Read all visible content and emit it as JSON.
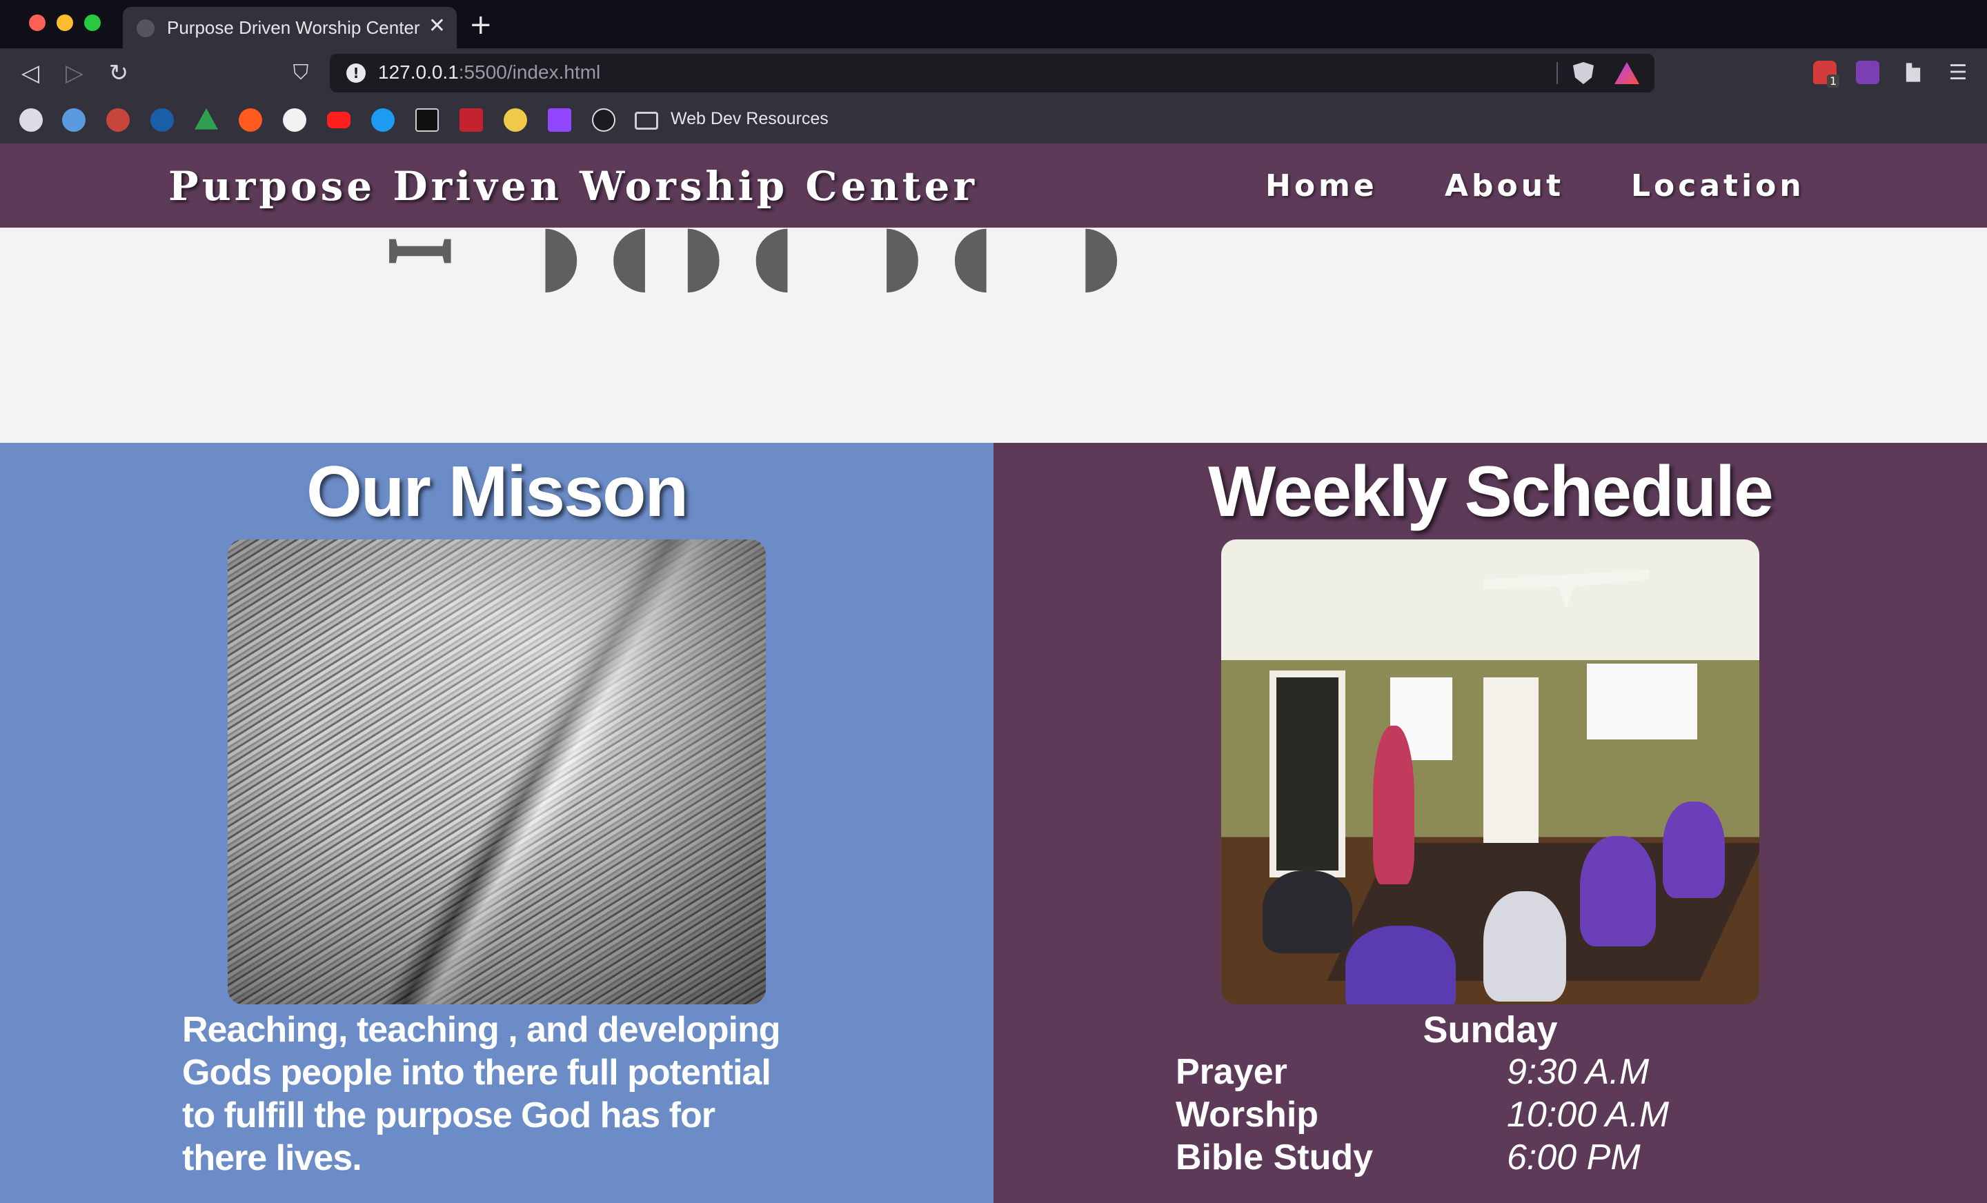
{
  "browser": {
    "tab_title": "Purpose Driven Worship Center",
    "tab_close": "✕",
    "new_tab": "+",
    "url_host": "127.0.0.1",
    "url_path": ":5500/index.html",
    "bookmark_folder_label": "Web Dev Resources",
    "extension_badge": "1",
    "nav_back": "◁",
    "nav_forward": "▷",
    "nav_reload": "↻",
    "menu": "☰"
  },
  "site": {
    "title": "Purpose Driven Worship Center",
    "nav": {
      "home": "Home",
      "about": "About",
      "location": "Location"
    }
  },
  "mission": {
    "heading": "Our Misson",
    "text": "Reaching, teaching , and developing Gods people into there full potential to fulfill the purpose God has for there lives."
  },
  "schedule": {
    "heading": "Weekly Schedule",
    "day": "Sunday",
    "items": [
      {
        "name": "Prayer",
        "time": "9:30 A.M"
      },
      {
        "name": "Worship",
        "time": "10:00 A.M"
      },
      {
        "name": "Bible Study",
        "time": "6:00 PM"
      }
    ]
  },
  "colors": {
    "header_bg": "#5c3a58",
    "mission_bg": "#6b8cc7",
    "schedule_bg": "#5c3a58"
  }
}
